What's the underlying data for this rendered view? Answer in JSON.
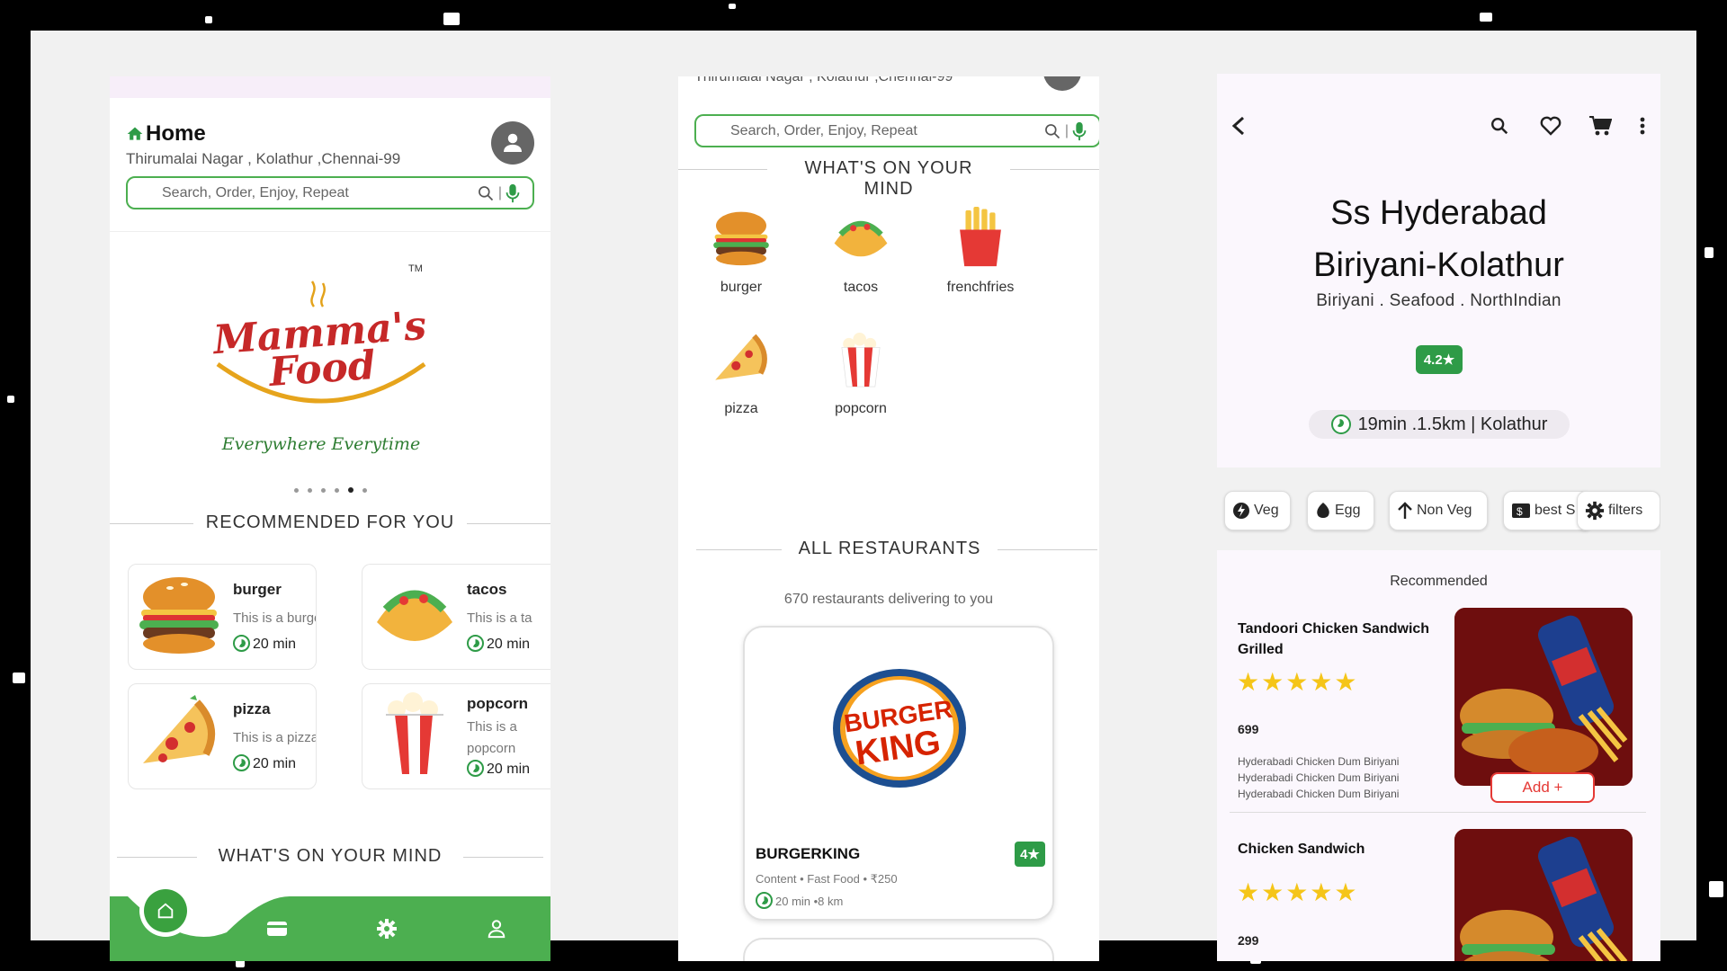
{
  "screen1": {
    "home_title": "Home",
    "address": "Thirumalai Nagar , Kolathur ,Chennai-99",
    "search_placeholder": "Search, Order, Enjoy, Repeat",
    "logo": {
      "text_line1": "Mamma's",
      "text_line2": "Food",
      "tagline": "Everywhere Everytime",
      "tm": "TM"
    },
    "carousel_total": 6,
    "carousel_active": 5,
    "recommended_heading": "RECOMMENDED FOR YOU",
    "recommended": [
      {
        "name": "burger",
        "desc": "This is a burger",
        "time": "20 min"
      },
      {
        "name": "tacos",
        "desc": "This is a ta",
        "time": "20 min"
      },
      {
        "name": "pizza",
        "desc": "This is a pizza",
        "time": "20 min"
      },
      {
        "name": "popcorn",
        "desc": "This is a popcorn",
        "time": "20 min"
      }
    ],
    "mind_heading": "WHAT'S ON YOUR MIND",
    "nav": [
      "home-icon",
      "wallet-icon",
      "settings-icon",
      "profile-icon"
    ],
    "nav_color": "#4caf50"
  },
  "screen2": {
    "address": "Thirumalai Nagar , Kolathur ,Chennai-99",
    "search_placeholder": "Search, Order, Enjoy, Repeat",
    "mind_heading": "WHAT'S ON YOUR MIND",
    "categories": [
      "burger",
      "tacos",
      "frenchfries",
      "pizza",
      "popcorn"
    ],
    "all_heading": "ALL RESTAURANTS",
    "delivering": "670 restaurants delivering to you",
    "restaurant": {
      "logo_line1": "BURGER",
      "logo_line2": "KING",
      "name": "BURGERKING",
      "rating": "4★",
      "meta": "Content • Fast Food • ₹250",
      "eta": "20 min •8 km"
    }
  },
  "screen3": {
    "title_line1": "Ss Hyderabad",
    "title_line2": "Biriyani-Kolathur",
    "cuisines": "Biriyani . Seafood . NorthIndian",
    "rating": "4.2★",
    "eta": "19min .1.5km | Kolathur",
    "chips": [
      "Veg",
      "Egg",
      "Non Veg",
      "best S",
      "filters"
    ],
    "section": "Recommended",
    "items": [
      {
        "name": "Tandoori Chicken Sandwich Grilled",
        "rating": 5,
        "price": "699",
        "desc": [
          "Hyderabadi Chicken Dum Biriyani",
          "Hyderabadi Chicken Dum Biriyani",
          "Hyderabadi Chicken Dum Biriyani"
        ],
        "add": "Add +"
      },
      {
        "name": "Chicken Sandwich",
        "rating": 5,
        "price": "299"
      }
    ]
  }
}
